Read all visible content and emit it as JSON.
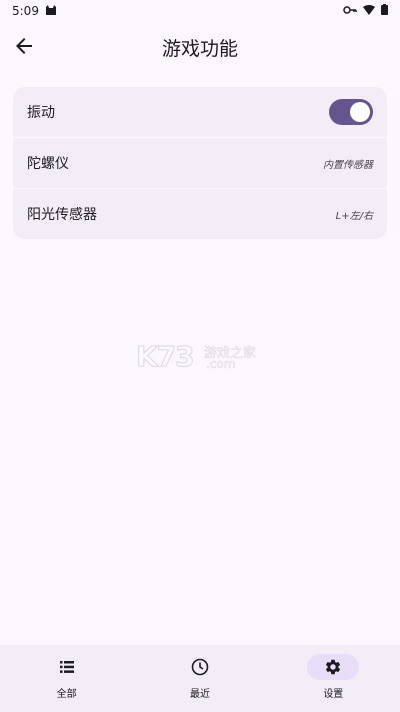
{
  "status": {
    "time": "5:09"
  },
  "header": {
    "title": "游戏功能"
  },
  "settings": [
    {
      "label": "振动",
      "type": "toggle",
      "enabled": true
    },
    {
      "label": "陀螺仪",
      "type": "value",
      "value": "内置传感器"
    },
    {
      "label": "阳光传感器",
      "type": "value",
      "value": "L+左/右"
    }
  ],
  "watermark": {
    "logo": "K73",
    "line1": "游戏之家",
    "line2": ".com"
  },
  "nav": {
    "items": [
      {
        "label": "全部",
        "icon": "list-icon",
        "active": false
      },
      {
        "label": "最近",
        "icon": "clock-icon",
        "active": false
      },
      {
        "label": "设置",
        "icon": "gear-icon",
        "active": true
      }
    ]
  },
  "colors": {
    "accent": "#65558f",
    "background": "#fdf7ff",
    "card": "#f3edf7",
    "active_indicator": "#e8def8"
  }
}
